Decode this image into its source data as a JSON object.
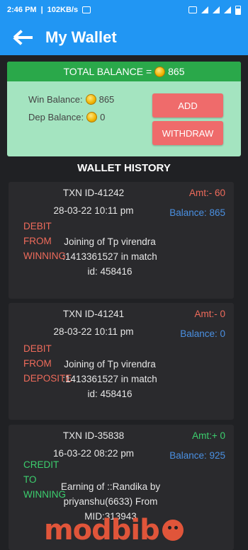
{
  "status_bar": {
    "time": "2:46 PM",
    "speed": "102KB/s"
  },
  "app_bar": {
    "title": "My Wallet"
  },
  "balance_card": {
    "total_label": "TOTAL BALANCE =",
    "total_value": "865",
    "win_label": "Win Balance:",
    "win_value": "865",
    "dep_label": "Dep Balance:",
    "dep_value": "0",
    "add_label": "ADD",
    "withdraw_label": "WITHDRAW"
  },
  "history": {
    "title": "WALLET HISTORY",
    "items": [
      {
        "txn_id": "TXN ID-41242",
        "date": "28-03-22 10:11 pm",
        "amount": "Amt:- 60",
        "balance": "Balance: 865",
        "type": "DEBIT FROM WINNING",
        "description": "Joining of Tp virendra :1413361527 in match id: 458416"
      },
      {
        "txn_id": "TXN ID-41241",
        "date": "28-03-22 10:11 pm",
        "amount": "Amt:- 0",
        "balance": "Balance: 0",
        "type": "DEBIT FROM DEPOSITE",
        "description": "Joining of Tp virendra :1413361527 in match id: 458416"
      },
      {
        "txn_id": "TXN ID-35838",
        "date": "16-03-22 08:22 pm",
        "amount": "Amt:+ 0",
        "balance": "Balance: 925",
        "type": "CREDIT TO WINNING",
        "description": "Earning of ::Randika by priyanshu(6633) From MID:313943"
      }
    ]
  },
  "watermark": {
    "text": "modbib"
  },
  "colors": {
    "primary": "#2196f3",
    "total_bar": "#2aa84a",
    "card_bg": "#a4e4c0",
    "button": "#ef6b6b",
    "debit": "#ef6b5b",
    "credit": "#3ccf6e",
    "balance_text": "#4a90e2"
  }
}
